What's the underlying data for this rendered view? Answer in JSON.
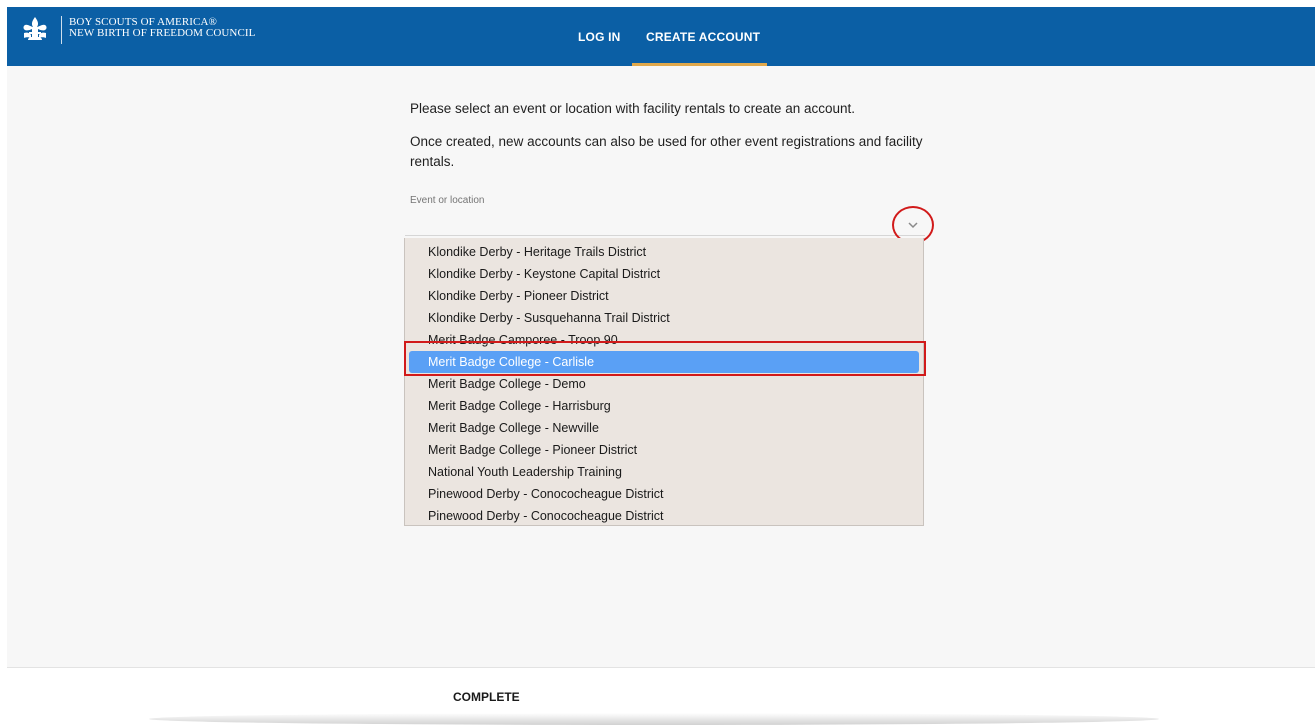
{
  "header": {
    "brand_line1": "BOY SCOUTS OF AMERICA®",
    "brand_line2": "NEW BIRTH OF FREEDOM COUNCIL",
    "logo_icon": "fleur-de-lis-icon",
    "tabs": [
      {
        "label": "LOG IN",
        "active": false
      },
      {
        "label": "CREATE ACCOUNT",
        "active": true
      }
    ],
    "bar_color": "#0b5fa5",
    "active_tab_accent": "#e0a84b"
  },
  "main": {
    "intro_1": "Please select an event or location with facility rentals to create an account.",
    "intro_2": "Once created, new accounts can also be used for other event registrations and facility rentals.",
    "field_label": "Event or location",
    "dropdown_icon": "chevron-down-icon",
    "options": [
      "Klondike Derby - Heritage Trails District",
      "Klondike Derby - Keystone Capital District",
      "Klondike Derby - Pioneer District",
      "Klondike Derby - Susquehanna Trail District",
      "Merit Badge Camporee - Troop 90",
      "Merit Badge College - Carlisle",
      "Merit Badge College - Demo",
      "Merit Badge College - Harrisburg",
      "Merit Badge College - Newville",
      "Merit Badge College - Pioneer District",
      "National Youth Leadership Training",
      "Pinewood Derby - Conococheague District",
      "Pinewood Derby - Conococheague District"
    ],
    "selected_option": "Merit Badge College - Carlisle",
    "selected_color": "#5aa0f5"
  },
  "footer": {
    "complete_label": "COMPLETE"
  }
}
